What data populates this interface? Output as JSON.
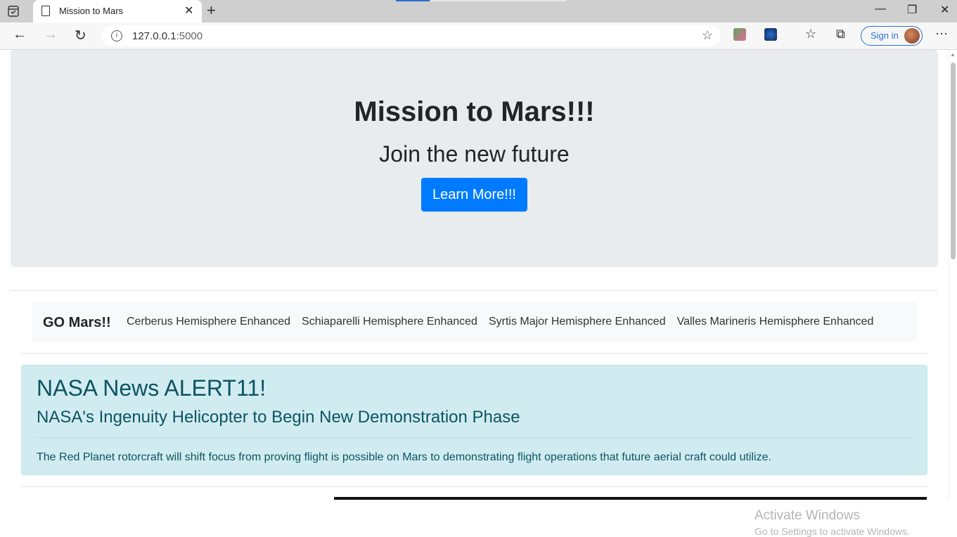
{
  "browser": {
    "tab_title": "Mission to Mars",
    "url_host": "127.0.0.1",
    "url_port": ":5000",
    "sign_in": "Sign in"
  },
  "hero": {
    "title": "Mission to Mars!!!",
    "subtitle": "Join the new future",
    "button": "Learn More!!!"
  },
  "nav": {
    "brand": "GO Mars!!",
    "links": [
      "Cerberus Hemisphere Enhanced",
      "Schiaparelli Hemisphere Enhanced",
      "Syrtis Major Hemisphere Enhanced",
      "Valles Marineris Hemisphere Enhanced"
    ]
  },
  "news": {
    "heading": "NASA News ALERT11!",
    "title": "NASA's Ingenuity Helicopter to Begin New Demonstration Phase",
    "paragraph": "The Red Planet rotorcraft will shift focus from proving flight is possible on Mars to demonstrating flight operations that future aerial craft could utilize."
  },
  "watermark": {
    "line1": "Activate Windows",
    "line2": "Go to Settings to activate Windows."
  },
  "colors": {
    "primary": "#007bff",
    "jumbotron": "#e9ecef",
    "alert_bg": "#d1ecf1",
    "alert_text": "#0c5460"
  }
}
